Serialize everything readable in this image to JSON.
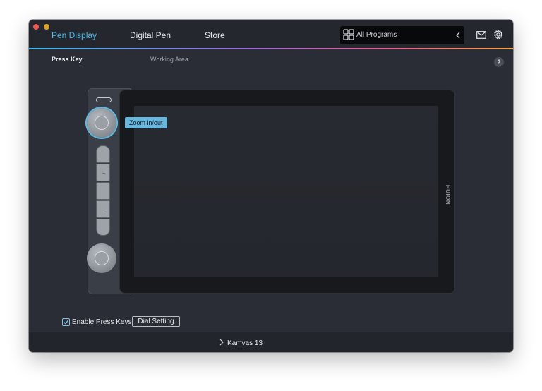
{
  "nav": {
    "tabs": [
      {
        "label": "Pen Display",
        "active": true
      },
      {
        "label": "Digital Pen",
        "active": false
      },
      {
        "label": "Store",
        "active": false
      }
    ],
    "program_select": {
      "label": "All Programs",
      "icon": "grid-icon"
    },
    "icons": [
      "mail-icon",
      "gear-icon"
    ]
  },
  "subtabs": [
    {
      "label": "Press Key",
      "active": true
    },
    {
      "label": "Working Area",
      "active": false
    }
  ],
  "help_icon": "?",
  "device": {
    "brand": "HUION",
    "tooltip": "Zoom in/out",
    "press_key_count": 5
  },
  "controls": {
    "enable_press_keys_label": "Enable Press Keys",
    "enable_press_keys_checked": true,
    "dial_setting_label": "Dial Setting"
  },
  "footer": {
    "device_label": "Kamvas 13"
  },
  "colors": {
    "accent": "#4fb8e6",
    "window_bg": "#2a2d35",
    "titlebar_bg": "#24272e"
  }
}
